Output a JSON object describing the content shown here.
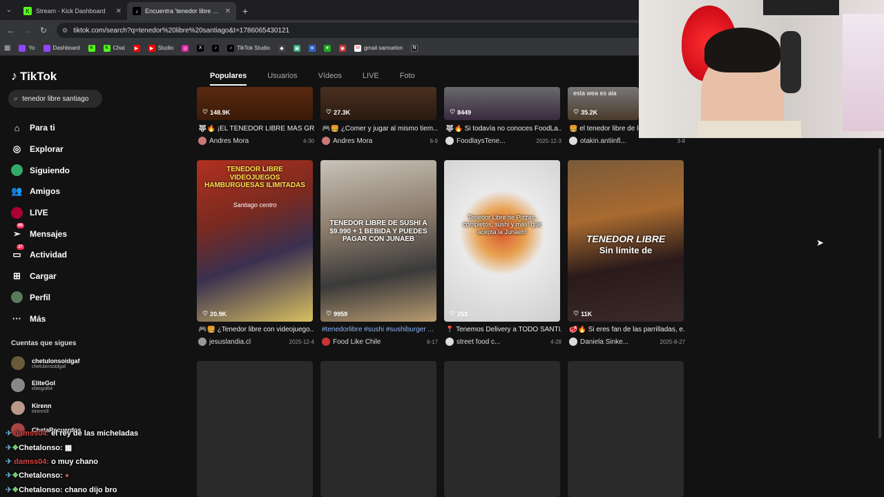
{
  "browser": {
    "tabs": [
      {
        "title": "Stream - Kick Dashboard",
        "active": false
      },
      {
        "title": "Encuentra 'tenedor libre santiago'",
        "active": true
      }
    ],
    "url": "tiktok.com/search?q=tenedor%20libre%20santiago&t=1786065430121",
    "bookmarks": [
      "Yo",
      "Dashboard",
      "Chat",
      "Studio",
      "TikTok Studio",
      "gmail samuelon"
    ]
  },
  "sidebar": {
    "logo": "TikTok",
    "search_value": "tenedor libre santiago",
    "menu": [
      {
        "label": "Para ti",
        "icon": "home-icon"
      },
      {
        "label": "Explorar",
        "icon": "compass-icon"
      },
      {
        "label": "Siguiendo",
        "icon": "following-icon"
      },
      {
        "label": "Amigos",
        "icon": "friends-icon"
      },
      {
        "label": "LIVE",
        "icon": "live-icon"
      },
      {
        "label": "Mensajes",
        "icon": "messages-icon",
        "badge": "68"
      },
      {
        "label": "Actividad",
        "icon": "activity-icon",
        "badge": "37"
      },
      {
        "label": "Cargar",
        "icon": "upload-icon"
      },
      {
        "label": "Perfil",
        "icon": "profile-icon"
      },
      {
        "label": "Más",
        "icon": "more-icon"
      }
    ],
    "follows_title": "Cuentas que sigues",
    "follows": [
      {
        "name": "chetulonsoidgaf",
        "handle": "chetulonsoidgaf"
      },
      {
        "name": "EliteGol",
        "handle": "elitegol64"
      },
      {
        "name": "Kirenn",
        "handle": "kirenn0l"
      },
      {
        "name": "ChetaRecuerdos",
        "handle": ""
      }
    ]
  },
  "search_tabs": [
    "Populares",
    "Usuarios",
    "Vídeos",
    "LIVE",
    "Foto"
  ],
  "row1": [
    {
      "likes": "148.9K",
      "caption": "¡EL TENEDOR LIBRE MÁS GRA...",
      "author": "Andres Mora",
      "date": "4-30"
    },
    {
      "likes": "27.3K",
      "caption": "¿Comer y jugar al mismo tiem...",
      "author": "Andres Mora",
      "date": "6-9"
    },
    {
      "likes": "8449",
      "caption": "Si todavía no conoces FoodLa...",
      "author": "FoodlaysTene...",
      "date": "2025-12-3"
    },
    {
      "likes": "35.2K",
      "caption": "el tenedor libre de lo",
      "author": "otakin.antiinfl...",
      "date": "3-8",
      "overlay": "esta wea es ala"
    }
  ],
  "row2": [
    {
      "likes": "20.9K",
      "caption": "¿Tenedor libre con videojuego...",
      "author": "jesuslandia.cl",
      "date": "2025-12-4",
      "overlay": "TENEDOR LIBRE VIDEOJUEGOS HAMBURGUESAS ILIMITADAS",
      "overlay2": "Santiago centro"
    },
    {
      "likes": "9959",
      "caption": "#tenedorlibre #sushi #sushiburger ...",
      "author": "Food Like Chile",
      "date": "6-17",
      "overlay": "TENEDOR LIBRE DE SUSHI A $9.990 + 1 BEBIDA Y PUEDES PAGAR CON JUNAEB"
    },
    {
      "likes": "253",
      "caption": "Tenemos Delivery a TODO SANTI...",
      "author": "street food c...",
      "date": "4-28",
      "overlay": "Tenedor Libre de Pizzas, completos, sushi y más! que acepta la Junaeb!"
    },
    {
      "likes": "11K",
      "caption": "Si eres fan de las parrilladas, e...",
      "author": "Daniela Sinke...",
      "date": "2025-8-27",
      "overlay": "TENEDOR LIBRE",
      "overlay2": "Sin límite de"
    }
  ],
  "chat": [
    {
      "user": "damss04:",
      "msg": "el rey de las micheladas"
    },
    {
      "user": "Chetalonso:",
      "msg": ""
    },
    {
      "user": "damss04:",
      "msg": "o muy chano"
    },
    {
      "user": "Chetalonso:",
      "msg": ""
    },
    {
      "user": "Chetalonso:",
      "msg": "chano dijo bro"
    }
  ],
  "colors": {
    "accent": "#fe2c55",
    "bg": "#121212",
    "kick_green": "#53fc18"
  }
}
